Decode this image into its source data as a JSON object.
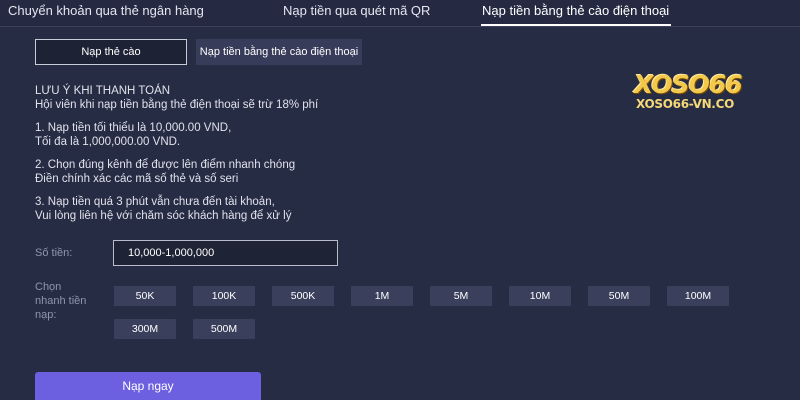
{
  "top_tabs": [
    {
      "label": "Chuyển khoản qua thẻ ngân hàng"
    },
    {
      "label": "Nạp tiền qua quét mã QR"
    },
    {
      "label": "Nạp tiền bằng thẻ cào điện thoại"
    }
  ],
  "active_top_tab": 2,
  "sub_tabs": [
    {
      "label": "Nạp thẻ cào"
    },
    {
      "label": "Nạp tiền bằng thẻ cào điện thoại"
    }
  ],
  "notice": {
    "title": "LƯU Ý KHI THANH TOÁN",
    "fee_line": "Hội viên khi nạp tiền bằng thẻ điện thoại sẽ trừ 18% phí",
    "rule1_line1": "1. Nạp tiền tối thiểu là 10,000.00 VND,",
    "rule1_line2": "Tối đa là 1,000,000.00 VND.",
    "rule2_line1": "2. Chọn đúng kênh để được lên điểm nhanh chóng",
    "rule2_line2": "Điền chính xác các mã số thẻ và số seri",
    "rule3_line1": "3. Nạp tiền quá 3 phút vẫn chưa đến tài khoản,",
    "rule3_line2": "Vui lòng liên hệ với chăm sóc khách hàng để xử lý"
  },
  "logo": {
    "main": "XOSO66",
    "sub": "XOSO66-VN.CO"
  },
  "amount": {
    "label": "Số tiền:",
    "placeholder": "10,000-1,000,000"
  },
  "quick_select": {
    "label_line1": "Chọn",
    "label_line2": "nhanh tiền",
    "label_line3": "nạp:",
    "options": [
      "50K",
      "100K",
      "500K",
      "1M",
      "5M",
      "10M",
      "50M",
      "100M",
      "300M",
      "500M"
    ]
  },
  "submit_label": "Nạp ngay",
  "colors": {
    "background": "#272c45",
    "button": "#6c5fe0",
    "chip": "#3a405c",
    "logo_gold": "#f2c94c"
  }
}
